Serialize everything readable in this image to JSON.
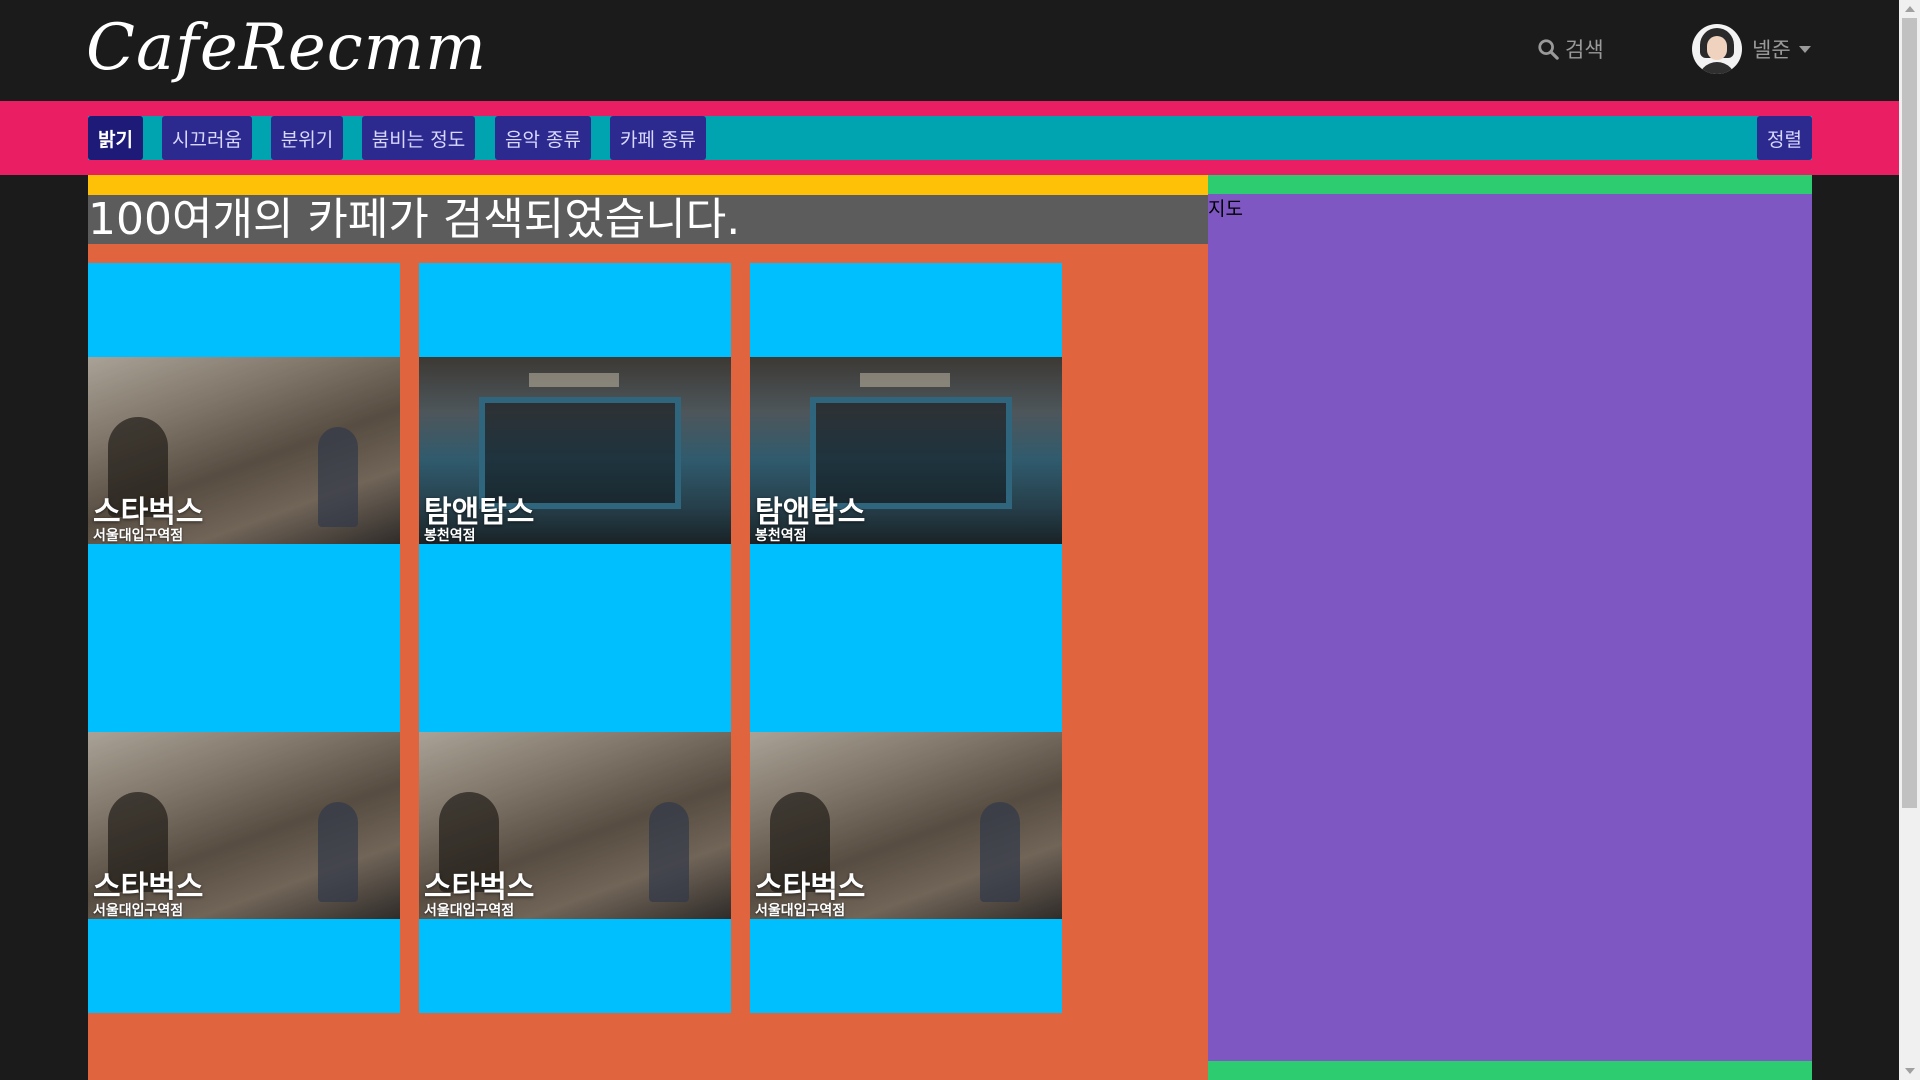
{
  "navbar": {
    "logo": "CafeRecmm",
    "search_label": "검색",
    "search_icon": "search-icon",
    "user_name": "넬준"
  },
  "filters": [
    {
      "label": "밝기",
      "active": true
    },
    {
      "label": "시끄러움",
      "active": false
    },
    {
      "label": "분위기",
      "active": false
    },
    {
      "label": "붐비는 정도",
      "active": false
    },
    {
      "label": "음악 종류",
      "active": false
    },
    {
      "label": "카페 종류",
      "active": false
    }
  ],
  "sort_label": "정렬",
  "result_text": "100여개의 카페가 검색되었습니다.",
  "map_label": "지도",
  "cafes": [
    {
      "name": "스타벅스",
      "branch": "서울대입구역점",
      "photo": "interior"
    },
    {
      "name": "탐앤탐스",
      "branch": "봉천역점",
      "photo": "facade"
    },
    {
      "name": "탐앤탐스",
      "branch": "봉천역점",
      "photo": "facade"
    },
    {
      "name": "스타벅스",
      "branch": "서울대입구역점",
      "photo": "interior"
    },
    {
      "name": "스타벅스",
      "branch": "서울대입구역점",
      "photo": "interior"
    },
    {
      "name": "스타벅스",
      "branch": "서울대입구역점",
      "photo": "interior"
    }
  ],
  "colors": {
    "navbar_bg": "#1b1b1b",
    "filter_bar_bg": "#e91e63",
    "filter_inner_bg": "#00a4b0",
    "filter_button_bg": "#2d2a8f",
    "list_bg": "#e0643d",
    "card_bg": "#00bfff",
    "map_bg": "#7e57c2",
    "accent_yellow": "#ffc107",
    "accent_green": "#2ecc71"
  }
}
